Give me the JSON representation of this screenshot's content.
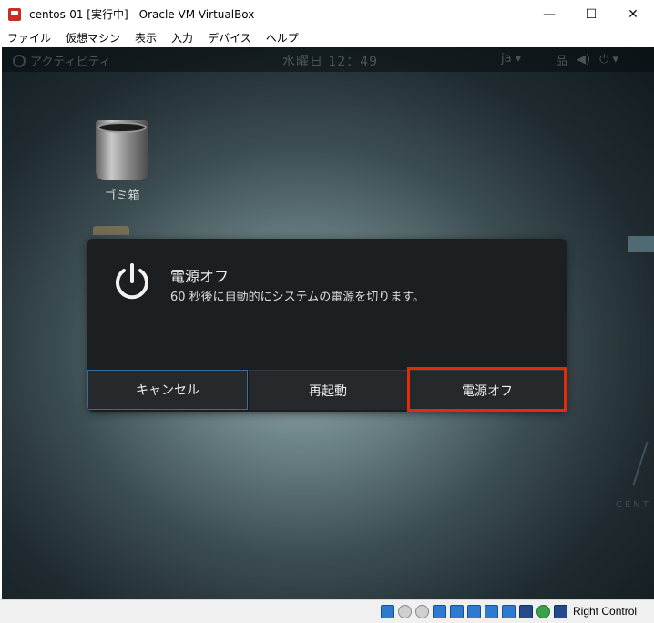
{
  "window": {
    "title": "centos-01 [実行中] - Oracle VM VirtualBox",
    "controls": {
      "minimize": "—",
      "maximize": "☐",
      "close": "✕"
    }
  },
  "menu": [
    "ファイル",
    "仮想マシン",
    "表示",
    "入力",
    "デバイス",
    "ヘルプ"
  ],
  "guest_topbar": {
    "activities": "アクティビティ",
    "clock": "水曜日 12：49",
    "language": "ja ▾",
    "status_icons": [
      "network-icon",
      "volume-icon",
      "power-icon"
    ],
    "status_glyphs": [
      "品",
      "◀)",
      "⏻ ▾"
    ]
  },
  "desktop": {
    "trash_label": "ゴミ箱",
    "watermark": "CENT"
  },
  "dialog": {
    "title": "電源オフ",
    "message": "60 秒後に自動的にシステムの電源を切ります。",
    "buttons": {
      "cancel": "キャンセル",
      "restart": "再起動",
      "power_off": "電源オフ"
    }
  },
  "statusbar": {
    "icons": [
      "hdd-icon",
      "optical-icon",
      "audio-icon",
      "network-adapter-icon",
      "usb-icon",
      "shared-folders-icon",
      "display-icon",
      "video-capture-icon",
      "cpu-icon",
      "mouse-integration-icon",
      "host-key-arrow-icon"
    ],
    "host_key": "Right Control"
  },
  "colors": {
    "highlight": "#e32b0c",
    "dialog_bg": "#1c1f22",
    "focus_border": "#3a6c9a"
  }
}
